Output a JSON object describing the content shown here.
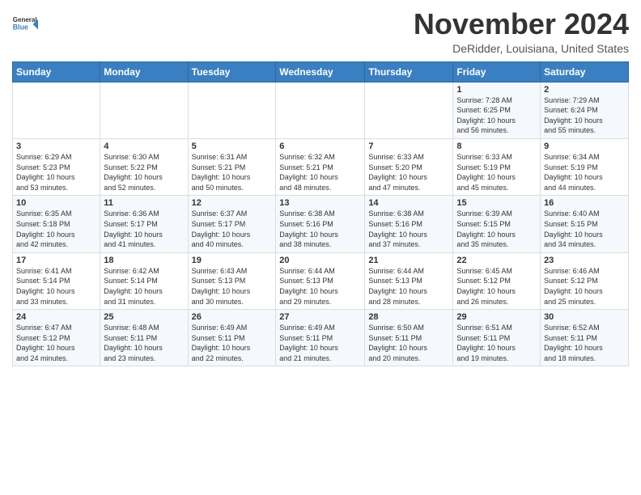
{
  "header": {
    "logo_line1": "General",
    "logo_line2": "Blue",
    "month": "November 2024",
    "location": "DeRidder, Louisiana, United States"
  },
  "weekdays": [
    "Sunday",
    "Monday",
    "Tuesday",
    "Wednesday",
    "Thursday",
    "Friday",
    "Saturday"
  ],
  "weeks": [
    [
      {
        "day": "",
        "info": ""
      },
      {
        "day": "",
        "info": ""
      },
      {
        "day": "",
        "info": ""
      },
      {
        "day": "",
        "info": ""
      },
      {
        "day": "",
        "info": ""
      },
      {
        "day": "1",
        "info": "Sunrise: 7:28 AM\nSunset: 6:25 PM\nDaylight: 10 hours\nand 56 minutes."
      },
      {
        "day": "2",
        "info": "Sunrise: 7:29 AM\nSunset: 6:24 PM\nDaylight: 10 hours\nand 55 minutes."
      }
    ],
    [
      {
        "day": "3",
        "info": "Sunrise: 6:29 AM\nSunset: 5:23 PM\nDaylight: 10 hours\nand 53 minutes."
      },
      {
        "day": "4",
        "info": "Sunrise: 6:30 AM\nSunset: 5:22 PM\nDaylight: 10 hours\nand 52 minutes."
      },
      {
        "day": "5",
        "info": "Sunrise: 6:31 AM\nSunset: 5:21 PM\nDaylight: 10 hours\nand 50 minutes."
      },
      {
        "day": "6",
        "info": "Sunrise: 6:32 AM\nSunset: 5:21 PM\nDaylight: 10 hours\nand 48 minutes."
      },
      {
        "day": "7",
        "info": "Sunrise: 6:33 AM\nSunset: 5:20 PM\nDaylight: 10 hours\nand 47 minutes."
      },
      {
        "day": "8",
        "info": "Sunrise: 6:33 AM\nSunset: 5:19 PM\nDaylight: 10 hours\nand 45 minutes."
      },
      {
        "day": "9",
        "info": "Sunrise: 6:34 AM\nSunset: 5:19 PM\nDaylight: 10 hours\nand 44 minutes."
      }
    ],
    [
      {
        "day": "10",
        "info": "Sunrise: 6:35 AM\nSunset: 5:18 PM\nDaylight: 10 hours\nand 42 minutes."
      },
      {
        "day": "11",
        "info": "Sunrise: 6:36 AM\nSunset: 5:17 PM\nDaylight: 10 hours\nand 41 minutes."
      },
      {
        "day": "12",
        "info": "Sunrise: 6:37 AM\nSunset: 5:17 PM\nDaylight: 10 hours\nand 40 minutes."
      },
      {
        "day": "13",
        "info": "Sunrise: 6:38 AM\nSunset: 5:16 PM\nDaylight: 10 hours\nand 38 minutes."
      },
      {
        "day": "14",
        "info": "Sunrise: 6:38 AM\nSunset: 5:16 PM\nDaylight: 10 hours\nand 37 minutes."
      },
      {
        "day": "15",
        "info": "Sunrise: 6:39 AM\nSunset: 5:15 PM\nDaylight: 10 hours\nand 35 minutes."
      },
      {
        "day": "16",
        "info": "Sunrise: 6:40 AM\nSunset: 5:15 PM\nDaylight: 10 hours\nand 34 minutes."
      }
    ],
    [
      {
        "day": "17",
        "info": "Sunrise: 6:41 AM\nSunset: 5:14 PM\nDaylight: 10 hours\nand 33 minutes."
      },
      {
        "day": "18",
        "info": "Sunrise: 6:42 AM\nSunset: 5:14 PM\nDaylight: 10 hours\nand 31 minutes."
      },
      {
        "day": "19",
        "info": "Sunrise: 6:43 AM\nSunset: 5:13 PM\nDaylight: 10 hours\nand 30 minutes."
      },
      {
        "day": "20",
        "info": "Sunrise: 6:44 AM\nSunset: 5:13 PM\nDaylight: 10 hours\nand 29 minutes."
      },
      {
        "day": "21",
        "info": "Sunrise: 6:44 AM\nSunset: 5:13 PM\nDaylight: 10 hours\nand 28 minutes."
      },
      {
        "day": "22",
        "info": "Sunrise: 6:45 AM\nSunset: 5:12 PM\nDaylight: 10 hours\nand 26 minutes."
      },
      {
        "day": "23",
        "info": "Sunrise: 6:46 AM\nSunset: 5:12 PM\nDaylight: 10 hours\nand 25 minutes."
      }
    ],
    [
      {
        "day": "24",
        "info": "Sunrise: 6:47 AM\nSunset: 5:12 PM\nDaylight: 10 hours\nand 24 minutes."
      },
      {
        "day": "25",
        "info": "Sunrise: 6:48 AM\nSunset: 5:11 PM\nDaylight: 10 hours\nand 23 minutes."
      },
      {
        "day": "26",
        "info": "Sunrise: 6:49 AM\nSunset: 5:11 PM\nDaylight: 10 hours\nand 22 minutes."
      },
      {
        "day": "27",
        "info": "Sunrise: 6:49 AM\nSunset: 5:11 PM\nDaylight: 10 hours\nand 21 minutes."
      },
      {
        "day": "28",
        "info": "Sunrise: 6:50 AM\nSunset: 5:11 PM\nDaylight: 10 hours\nand 20 minutes."
      },
      {
        "day": "29",
        "info": "Sunrise: 6:51 AM\nSunset: 5:11 PM\nDaylight: 10 hours\nand 19 minutes."
      },
      {
        "day": "30",
        "info": "Sunrise: 6:52 AM\nSunset: 5:11 PM\nDaylight: 10 hours\nand 18 minutes."
      }
    ]
  ]
}
